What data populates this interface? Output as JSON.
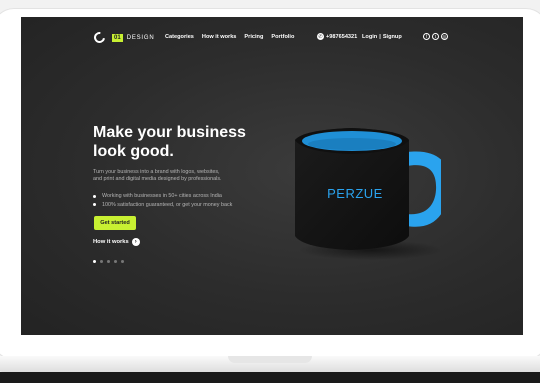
{
  "brand": {
    "badge": "01",
    "name": "DESIGN"
  },
  "nav": {
    "items": [
      "Categories",
      "How it works",
      "Pricing",
      "Portfolio"
    ]
  },
  "phone": "+987654321",
  "auth": {
    "login": "Login",
    "separator": "|",
    "signup": "Signup"
  },
  "social": [
    {
      "icon": "facebook-icon",
      "glyph": "f"
    },
    {
      "icon": "twitter-icon",
      "glyph": "t"
    },
    {
      "icon": "instagram-icon",
      "glyph": "◎"
    }
  ],
  "hero": {
    "title_line1": "Make your business",
    "title_line2": "look good.",
    "subtitle_line1": "Turn your business into a brand with logos, websites,",
    "subtitle_line2": "and print and digital media designed by professionals.",
    "bullets": [
      "Working with businesses in 50+ cities across India",
      "100% satisfaction guaranteed, or get your money back"
    ],
    "cta": "Get started",
    "how_it_works": "How it works"
  },
  "carousel": {
    "count": 5,
    "active": 0
  },
  "mug": {
    "brand": "PERZUE"
  },
  "colors": {
    "accent": "#c8f032",
    "background": "#2b2b2b",
    "mug_inner": "#1f8fd6"
  }
}
